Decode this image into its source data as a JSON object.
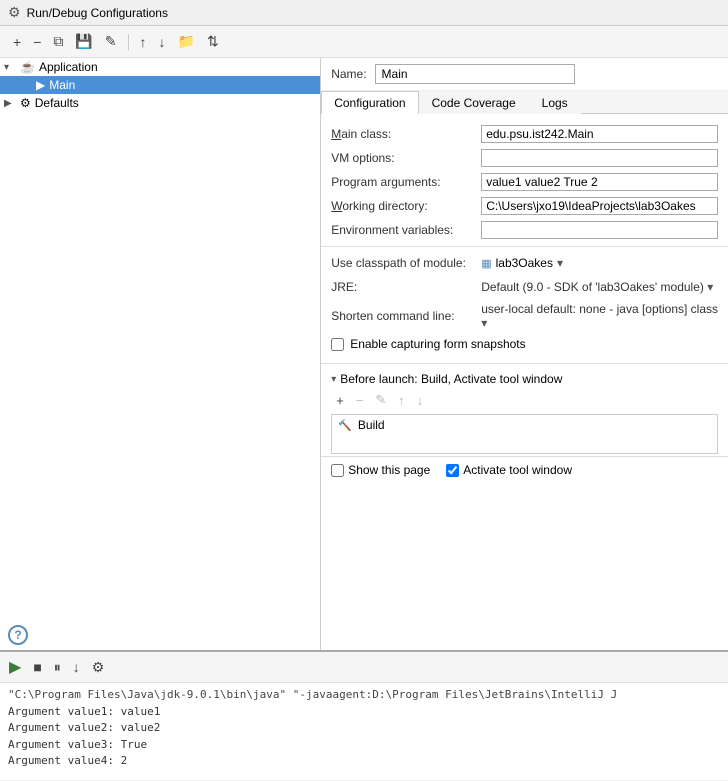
{
  "titleBar": {
    "icon": "⚙",
    "title": "Run/Debug Configurations"
  },
  "toolbar": {
    "addBtn": "+",
    "removeBtn": "−",
    "copyBtn": "⧉",
    "saveBtn": "💾",
    "editTemplatesBtn": "✎",
    "moveUpBtn": "↑",
    "moveDownBtn": "↓",
    "folderBtn": "📁",
    "sortBtn": "⇅"
  },
  "tree": {
    "items": [
      {
        "id": "application",
        "label": "Application",
        "indent": 0,
        "expanded": true,
        "icon": "▾",
        "itemIcon": "☕",
        "selected": false
      },
      {
        "id": "main",
        "label": "Main",
        "indent": 1,
        "icon": "",
        "itemIcon": "▶",
        "selected": true
      },
      {
        "id": "defaults",
        "label": "Defaults",
        "indent": 0,
        "expanded": false,
        "icon": "▶",
        "itemIcon": "⚙",
        "selected": false
      }
    ]
  },
  "nameField": {
    "label": "Name:",
    "value": "Main"
  },
  "tabs": [
    {
      "id": "configuration",
      "label": "Configuration",
      "active": true
    },
    {
      "id": "code-coverage",
      "label": "Code Coverage",
      "active": false
    },
    {
      "id": "logs",
      "label": "Logs",
      "active": false
    }
  ],
  "form": {
    "mainClassLabel": "Main class:",
    "mainClassValue": "edu.psu.ist242.Main",
    "vmOptionsLabel": "VM options:",
    "vmOptionsValue": "",
    "programArgsLabel": "Program arguments:",
    "programArgsValue": "value1 value2 True 2",
    "workingDirLabel": "Working directory:",
    "workingDirValue": "C:\\Users\\jxo19\\IdeaProjects\\lab3Oakes",
    "envVarsLabel": "Environment variables:",
    "envVarsValue": "",
    "classpathLabel": "Use classpath of module:",
    "classpathValue": "lab3Oakes",
    "jreLabel": "JRE:",
    "jreValue": "Default (9.0 - SDK of 'lab3Oakes' module)",
    "shortenLabel": "Shorten command line:",
    "shortenValue": "user-local default: none - java [options] class",
    "enableCaptureLabel": "Enable capturing form snapshots"
  },
  "beforeLaunch": {
    "sectionTitle": "Before launch: Build, Activate tool window",
    "toolbar": {
      "addBtn": "+",
      "removeBtn": "−",
      "editBtn": "✎",
      "moveUpBtn": "↑",
      "moveDownBtn": "↓"
    },
    "items": [
      {
        "label": "Build",
        "icon": "🔨"
      }
    ]
  },
  "bottomOptions": {
    "showThisPage": "Show this page",
    "showChecked": false,
    "activateToolWindow": "Activate tool window",
    "activateChecked": true
  },
  "console": {
    "runBtn": "▶",
    "stopBtn": "■",
    "pauseBtn": "⏸",
    "lines": [
      {
        "type": "cmd",
        "text": "\"C:\\Program Files\\Java\\jdk-9.0.1\\bin\\java\" \"-javaagent:D:\\Program Files\\JetBrains\\IntelliJ J"
      },
      {
        "type": "arg",
        "text": "Argument value1: value1"
      },
      {
        "type": "arg",
        "text": "Argument value2: value2"
      },
      {
        "type": "arg",
        "text": "Argument value3: True"
      },
      {
        "type": "arg",
        "text": "Argument value4: 2"
      }
    ]
  },
  "helpBtn": "?"
}
